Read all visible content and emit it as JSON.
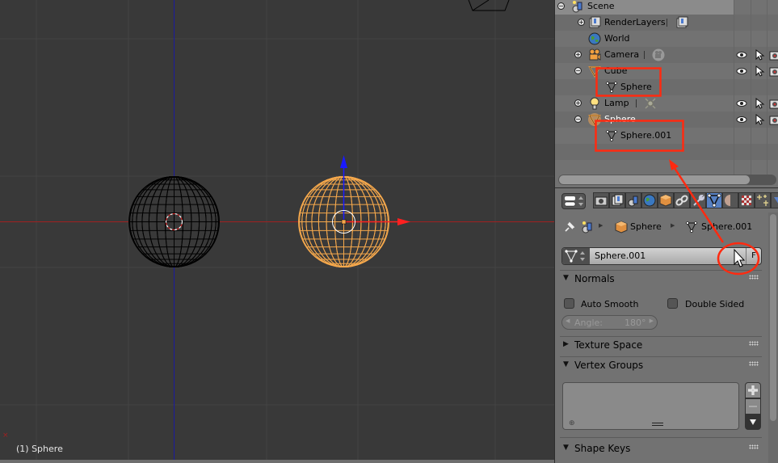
{
  "viewport": {
    "object_label": "(1) Sphere",
    "colors": {
      "background": "#393939",
      "grid": "#444444",
      "x_axis": "#a02020",
      "y_axis": "#1a1aa0",
      "selected_wire": "#f5a84c",
      "unselected_wire": "#000000"
    }
  },
  "outliner": {
    "rows": [
      {
        "label": "Scene",
        "icon": "scene-icon",
        "expander": "minus",
        "level": 0,
        "selected": true
      },
      {
        "label": "RenderLayers",
        "icon": "render-layers-icon",
        "expander": "plus",
        "level": 1,
        "extra_icon": "render-layer-icon"
      },
      {
        "label": "World",
        "icon": "world-icon",
        "expander": null,
        "level": 1
      },
      {
        "label": "Camera",
        "icon": "camera-object-icon",
        "expander": "plus",
        "level": 1,
        "extra_icon": "camera-data-icon",
        "restrict": true
      },
      {
        "label": "Cube",
        "icon": "mesh-object-icon",
        "expander": "minus",
        "level": 1,
        "restrict": true
      },
      {
        "label": "Sphere",
        "icon": "mesh-data-icon",
        "expander": null,
        "level": 2
      },
      {
        "label": "Lamp",
        "icon": "lamp-object-icon",
        "expander": "plus",
        "level": 1,
        "extra_icon": "lamp-data-icon",
        "restrict": true
      },
      {
        "label": "Sphere",
        "icon": "mesh-object-icon",
        "expander": "minus",
        "level": 1,
        "restrict": true,
        "active": true
      },
      {
        "label": "Sphere.001",
        "icon": "mesh-data-icon",
        "expander": null,
        "level": 2
      }
    ]
  },
  "properties": {
    "tabs": [
      "render",
      "render-layers",
      "scene",
      "world",
      "object",
      "constraints",
      "modifiers",
      "data",
      "material",
      "texture",
      "particles",
      "physics"
    ],
    "active_tab": "data",
    "breadcrumb": {
      "object": "Sphere",
      "data": "Sphere.001"
    },
    "datablock": {
      "name": "Sphere.001",
      "fake_user_label": "F"
    },
    "panels": {
      "normals": {
        "title": "Normals",
        "expanded": true,
        "auto_smooth_label": "Auto Smooth",
        "auto_smooth_checked": false,
        "double_sided_label": "Double Sided",
        "double_sided_checked": false,
        "angle_label": "Angle:",
        "angle_value": "180°"
      },
      "texture_space": {
        "title": "Texture Space",
        "expanded": false
      },
      "vertex_groups": {
        "title": "Vertex Groups",
        "expanded": true
      },
      "shape_keys": {
        "title": "Shape Keys",
        "expanded": true
      }
    }
  },
  "annotations": {
    "color": "#ff2a10"
  }
}
